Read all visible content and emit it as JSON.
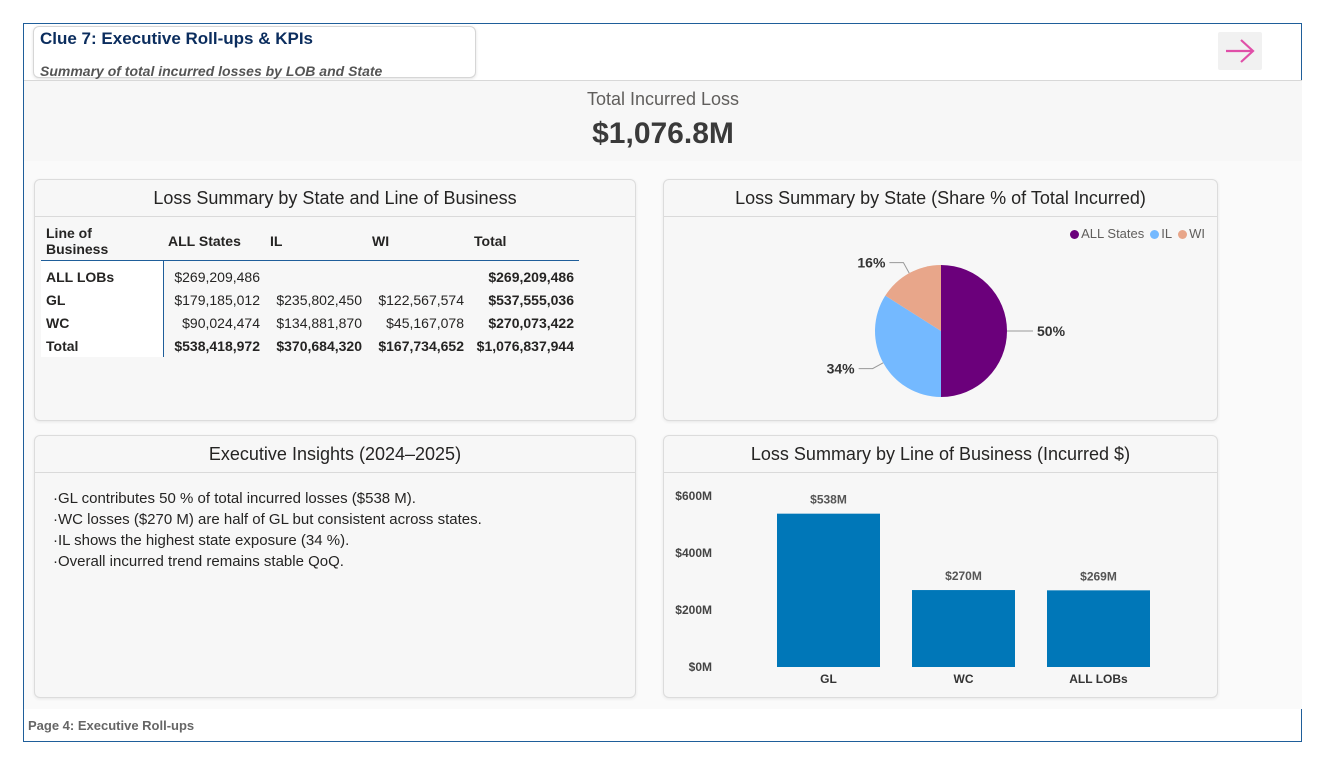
{
  "header": {
    "title": "Clue 7: Executive Roll-ups & KPIs",
    "subtitle": "Summary of total incurred losses by LOB and State",
    "next_icon": "arrow-right-icon",
    "accent_color": "#e04fa8"
  },
  "kpi": {
    "label": "Total Incurred Loss",
    "value": "$1,076.8M"
  },
  "loss_table": {
    "title": "Loss Summary by State and Line of Business",
    "columns": [
      "Line of Business",
      "ALL States",
      "IL",
      "WI",
      "Total"
    ],
    "rows": [
      [
        "ALL LOBs",
        "$269,209,486",
        "",
        "",
        "$269,209,486"
      ],
      [
        "GL",
        "$179,185,012",
        "$235,802,450",
        "$122,567,574",
        "$537,555,036"
      ],
      [
        "WC",
        "$90,024,474",
        "$134,881,870",
        "$45,167,078",
        "$270,073,422"
      ],
      [
        "Total",
        "$538,418,972",
        "$370,684,320",
        "$167,734,652",
        "$1,076,837,944"
      ]
    ]
  },
  "insights": {
    "title": "Executive Insights (2024–2025)",
    "bullets": [
      "GL contributes 50 % of total incurred losses ($538 M).",
      "WC losses ($270 M) are half of GL but consistent across states.",
      "IL shows the highest state exposure (34 %).",
      "Overall incurred trend remains stable QoQ."
    ]
  },
  "chart_data": [
    {
      "type": "pie",
      "title": "Loss Summary by State (Share % of Total Incurred)",
      "legend_position": "top-right",
      "categories": [
        "ALL States",
        "IL",
        "WI"
      ],
      "values": [
        50,
        34,
        16
      ],
      "labels": [
        "50%",
        "34%",
        "16%"
      ],
      "colors": [
        "#6b007b",
        "#74b9ff",
        "#e8a68a"
      ]
    },
    {
      "type": "bar",
      "title": "Loss Summary by Line of Business (Incurred $)",
      "categories": [
        "GL",
        "WC",
        "ALL LOBs"
      ],
      "values": [
        538,
        270,
        269
      ],
      "data_labels": [
        "$538M",
        "$270M",
        "$269M"
      ],
      "yticks": [
        "$0M",
        "$200M",
        "$400M",
        "$600M"
      ],
      "ylim": [
        0,
        600
      ],
      "color": "#0077b8",
      "grid": false
    }
  ],
  "footer": {
    "page_label": "Page 4: Executive Roll-ups"
  }
}
